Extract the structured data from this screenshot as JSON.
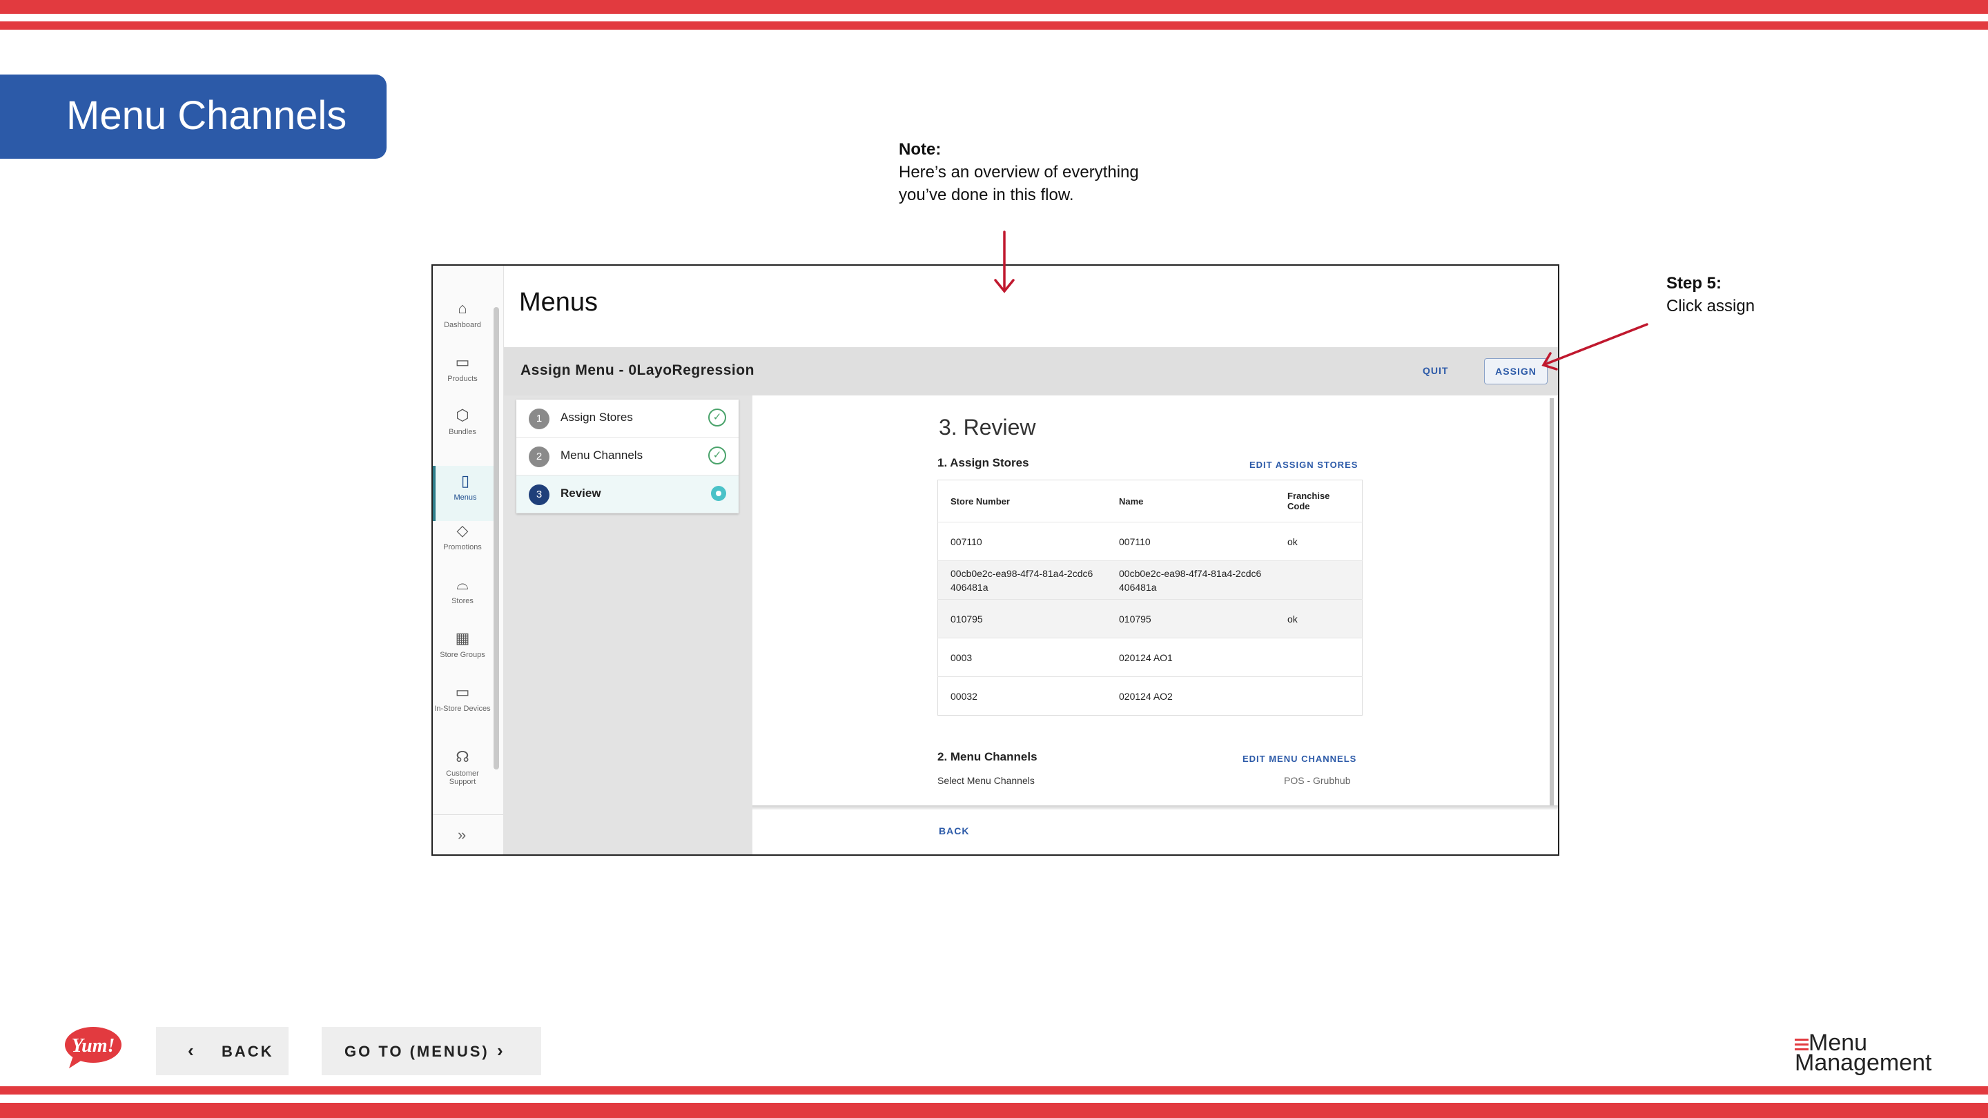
{
  "slide": {
    "title": "Menu Channels",
    "note_heading": "Note:",
    "note_text_1": "Here’s an overview of everything",
    "note_text_2": "you’ve done in this flow.",
    "step_heading": "Step 5:",
    "step_text": "Click assign"
  },
  "sidebar": {
    "items": [
      {
        "label": "Dashboard",
        "icon": "home-icon"
      },
      {
        "label": "Products",
        "icon": "calendar-icon"
      },
      {
        "label": "Bundles",
        "icon": "box-icon"
      },
      {
        "label": "Menus",
        "icon": "document-icon"
      },
      {
        "label": "Promotions",
        "icon": "tag-icon"
      },
      {
        "label": "Stores",
        "icon": "storefront-icon"
      },
      {
        "label": "Store Groups",
        "icon": "grid-icon"
      },
      {
        "label": "In-Store Devices",
        "icon": "monitor-icon"
      },
      {
        "label": "Customer Support",
        "icon": "headset-icon"
      }
    ],
    "expand_icon": "double-chevron-right-icon"
  },
  "page": {
    "title": "Menus",
    "assign_title": "Assign Menu - 0LayoRegression",
    "quit_label": "QUIT",
    "assign_label": "ASSIGN"
  },
  "stepper": [
    {
      "num": "1",
      "label": "Assign Stores",
      "state": "done"
    },
    {
      "num": "2",
      "label": "Menu Channels",
      "state": "done"
    },
    {
      "num": "3",
      "label": "Review",
      "state": "current"
    }
  ],
  "review": {
    "title": "3. Review",
    "assign_section": "1. Assign Stores",
    "edit_assign": "EDIT ASSIGN STORES",
    "columns": [
      "Store Number",
      "Name",
      "Franchise Code"
    ],
    "rows": [
      {
        "store": "007110",
        "name": "007110",
        "code": "ok"
      },
      {
        "store": "00cb0e2c-ea98-4f74-81a4-2cdc6406481a",
        "name": "00cb0e2c-ea98-4f74-81a4-2cdc6406481a",
        "code": ""
      },
      {
        "store": "010795",
        "name": "010795",
        "code": "ok"
      },
      {
        "store": "0003",
        "name": "020124 AO1",
        "code": ""
      },
      {
        "store": "00032",
        "name": "020124 AO2",
        "code": ""
      }
    ],
    "channels_section": "2. Menu Channels",
    "edit_channels": "EDIT MENU CHANNELS",
    "select_label": "Select Menu Channels",
    "channel_value": "POS - Grubhub",
    "back_label": "BACK"
  },
  "footer": {
    "back": "BACK",
    "goto": "GO TO (MENUS)",
    "logo_text": "Yum!",
    "brand_line1": "Menu",
    "brand_line2": "Management"
  },
  "colors": {
    "stripe": "#e23a3f",
    "title_blue": "#2c5aa8",
    "annotation_arrow": "#c0182e",
    "success": "#4aa36b",
    "active_dot": "#4ac2c8"
  }
}
